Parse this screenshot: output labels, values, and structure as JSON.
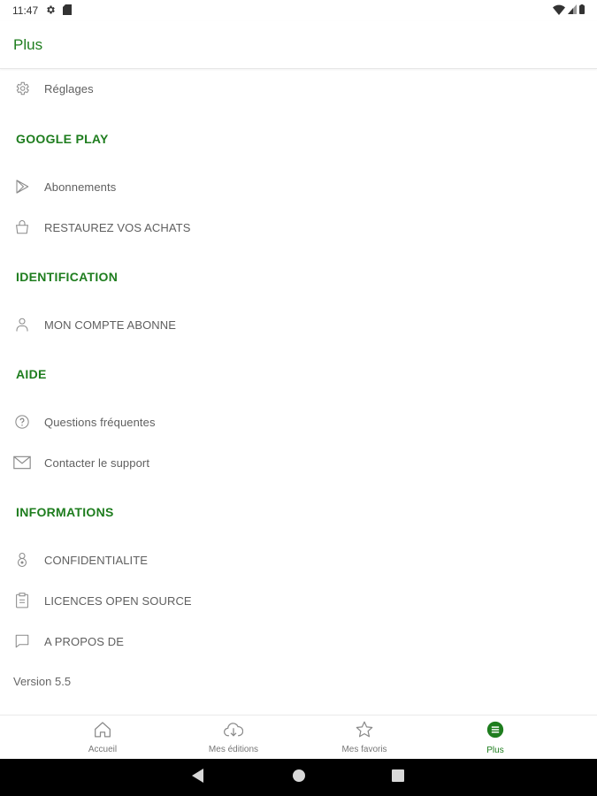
{
  "status_bar": {
    "time": "11:47"
  },
  "app_bar": {
    "title": "Plus"
  },
  "items": {
    "settings": "Réglages",
    "subscriptions": "Abonnements",
    "restore": "RESTAUREZ VOS ACHATS",
    "account": "MON COMPTE ABONNE",
    "faq": "Questions fréquentes",
    "support": "Contacter le support",
    "privacy": "CONFIDENTIALITE",
    "licenses": "LICENCES OPEN SOURCE",
    "about": "A PROPOS DE"
  },
  "sections": {
    "google_play": "GOOGLE PLAY",
    "identification": "IDENTIFICATION",
    "help": "AIDE",
    "informations": "INFORMATIONS"
  },
  "version": "Version 5.5",
  "bottom_nav": [
    {
      "label": "Accueil",
      "icon": "home-icon"
    },
    {
      "label": "Mes éditions",
      "icon": "cloud-download-icon"
    },
    {
      "label": "Mes favoris",
      "icon": "star-icon"
    },
    {
      "label": "Plus",
      "icon": "menu-circle-icon",
      "active": true
    }
  ],
  "colors": {
    "accent": "#1e7d1e",
    "icon": "#8a8a8a",
    "text": "#5f5f5f"
  }
}
